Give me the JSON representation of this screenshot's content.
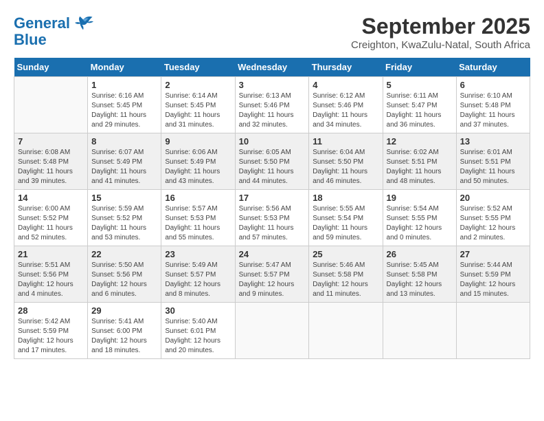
{
  "header": {
    "logo_line1": "General",
    "logo_line2": "Blue",
    "title": "September 2025",
    "subtitle": "Creighton, KwaZulu-Natal, South Africa"
  },
  "days_of_week": [
    "Sunday",
    "Monday",
    "Tuesday",
    "Wednesday",
    "Thursday",
    "Friday",
    "Saturday"
  ],
  "weeks": [
    [
      {
        "day": "",
        "info": ""
      },
      {
        "day": "1",
        "info": "Sunrise: 6:16 AM\nSunset: 5:45 PM\nDaylight: 11 hours\nand 29 minutes."
      },
      {
        "day": "2",
        "info": "Sunrise: 6:14 AM\nSunset: 5:45 PM\nDaylight: 11 hours\nand 31 minutes."
      },
      {
        "day": "3",
        "info": "Sunrise: 6:13 AM\nSunset: 5:46 PM\nDaylight: 11 hours\nand 32 minutes."
      },
      {
        "day": "4",
        "info": "Sunrise: 6:12 AM\nSunset: 5:46 PM\nDaylight: 11 hours\nand 34 minutes."
      },
      {
        "day": "5",
        "info": "Sunrise: 6:11 AM\nSunset: 5:47 PM\nDaylight: 11 hours\nand 36 minutes."
      },
      {
        "day": "6",
        "info": "Sunrise: 6:10 AM\nSunset: 5:48 PM\nDaylight: 11 hours\nand 37 minutes."
      }
    ],
    [
      {
        "day": "7",
        "info": "Sunrise: 6:08 AM\nSunset: 5:48 PM\nDaylight: 11 hours\nand 39 minutes."
      },
      {
        "day": "8",
        "info": "Sunrise: 6:07 AM\nSunset: 5:49 PM\nDaylight: 11 hours\nand 41 minutes."
      },
      {
        "day": "9",
        "info": "Sunrise: 6:06 AM\nSunset: 5:49 PM\nDaylight: 11 hours\nand 43 minutes."
      },
      {
        "day": "10",
        "info": "Sunrise: 6:05 AM\nSunset: 5:50 PM\nDaylight: 11 hours\nand 44 minutes."
      },
      {
        "day": "11",
        "info": "Sunrise: 6:04 AM\nSunset: 5:50 PM\nDaylight: 11 hours\nand 46 minutes."
      },
      {
        "day": "12",
        "info": "Sunrise: 6:02 AM\nSunset: 5:51 PM\nDaylight: 11 hours\nand 48 minutes."
      },
      {
        "day": "13",
        "info": "Sunrise: 6:01 AM\nSunset: 5:51 PM\nDaylight: 11 hours\nand 50 minutes."
      }
    ],
    [
      {
        "day": "14",
        "info": "Sunrise: 6:00 AM\nSunset: 5:52 PM\nDaylight: 11 hours\nand 52 minutes."
      },
      {
        "day": "15",
        "info": "Sunrise: 5:59 AM\nSunset: 5:52 PM\nDaylight: 11 hours\nand 53 minutes."
      },
      {
        "day": "16",
        "info": "Sunrise: 5:57 AM\nSunset: 5:53 PM\nDaylight: 11 hours\nand 55 minutes."
      },
      {
        "day": "17",
        "info": "Sunrise: 5:56 AM\nSunset: 5:53 PM\nDaylight: 11 hours\nand 57 minutes."
      },
      {
        "day": "18",
        "info": "Sunrise: 5:55 AM\nSunset: 5:54 PM\nDaylight: 11 hours\nand 59 minutes."
      },
      {
        "day": "19",
        "info": "Sunrise: 5:54 AM\nSunset: 5:55 PM\nDaylight: 12 hours\nand 0 minutes."
      },
      {
        "day": "20",
        "info": "Sunrise: 5:52 AM\nSunset: 5:55 PM\nDaylight: 12 hours\nand 2 minutes."
      }
    ],
    [
      {
        "day": "21",
        "info": "Sunrise: 5:51 AM\nSunset: 5:56 PM\nDaylight: 12 hours\nand 4 minutes."
      },
      {
        "day": "22",
        "info": "Sunrise: 5:50 AM\nSunset: 5:56 PM\nDaylight: 12 hours\nand 6 minutes."
      },
      {
        "day": "23",
        "info": "Sunrise: 5:49 AM\nSunset: 5:57 PM\nDaylight: 12 hours\nand 8 minutes."
      },
      {
        "day": "24",
        "info": "Sunrise: 5:47 AM\nSunset: 5:57 PM\nDaylight: 12 hours\nand 9 minutes."
      },
      {
        "day": "25",
        "info": "Sunrise: 5:46 AM\nSunset: 5:58 PM\nDaylight: 12 hours\nand 11 minutes."
      },
      {
        "day": "26",
        "info": "Sunrise: 5:45 AM\nSunset: 5:58 PM\nDaylight: 12 hours\nand 13 minutes."
      },
      {
        "day": "27",
        "info": "Sunrise: 5:44 AM\nSunset: 5:59 PM\nDaylight: 12 hours\nand 15 minutes."
      }
    ],
    [
      {
        "day": "28",
        "info": "Sunrise: 5:42 AM\nSunset: 5:59 PM\nDaylight: 12 hours\nand 17 minutes."
      },
      {
        "day": "29",
        "info": "Sunrise: 5:41 AM\nSunset: 6:00 PM\nDaylight: 12 hours\nand 18 minutes."
      },
      {
        "day": "30",
        "info": "Sunrise: 5:40 AM\nSunset: 6:01 PM\nDaylight: 12 hours\nand 20 minutes."
      },
      {
        "day": "",
        "info": ""
      },
      {
        "day": "",
        "info": ""
      },
      {
        "day": "",
        "info": ""
      },
      {
        "day": "",
        "info": ""
      }
    ]
  ]
}
